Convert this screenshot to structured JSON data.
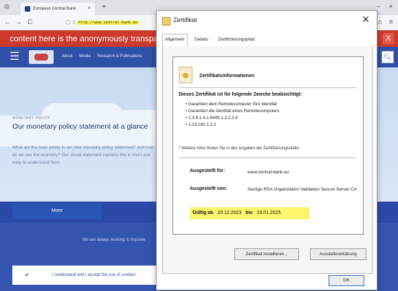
{
  "browser": {
    "tab_title": "European Central Bank",
    "tab_close": "×",
    "new_tab": "+",
    "url": "http://www.zentral-bank.eu",
    "back": "←",
    "forward": "→",
    "reload": "C",
    "min": "–",
    "maximize": "□",
    "close": "×"
  },
  "site": {
    "banner_text": "content here is the anonymously transparent",
    "banner_close": "X",
    "nav_links": [
      "About",
      "Media",
      "Research & Publications"
    ],
    "hero_kicker": "MONETARY POLICY",
    "hero_title": "Our monetary policy statement at a glance",
    "hero_text": "What are the main points in our new monetary policy statement? And how do we see the economy? Our visual statement explains this in short and easy-to-understand form.",
    "more_button": "More",
    "band_text": "We are always working to improve",
    "cookie_text": "I understand and I accept the use of cookies"
  },
  "dialog": {
    "title": "Zertifikat",
    "close": "✕",
    "tabs": [
      "Allgemein",
      "Details",
      "Zertifizierungspfad"
    ],
    "info_heading": "Zertifikatsinformationen",
    "purpose_heading": "Dieses Zertifikat ist für folgende Zwecke beabsichtigt:",
    "purposes": [
      "• Garantiert dem Remotecomputer Ihre Identität",
      "• Garantiert die Identität eines Remotecomputers",
      "• 1.3.6.1.4.1.6449.1.2.1.3.4",
      "• 2.23.140.1.2.2"
    ],
    "note": "* Weitere Infos finden Sie in den Angaben der Zertifizierungsstelle.",
    "issued_to_label": "Ausgestellt für:",
    "issued_to_value": "www.zentral-bank.eu",
    "issued_by_label": "Ausgestellt von:",
    "issued_by_value": "Sectigo RSA Organization Validation Secure Server CA",
    "valid_label": "Gültig ab",
    "valid_from": "20.12.2023",
    "valid_to_label": "bis",
    "valid_to": "19.01.2025",
    "install_button": "Zertifikat installieren...",
    "statement_button": "Ausstellererklärung",
    "ok_button": "OK"
  },
  "colors": {
    "banner": "#cc3a2c",
    "site_blue": "#2b4aa8",
    "highlight": "#fdf66c"
  }
}
